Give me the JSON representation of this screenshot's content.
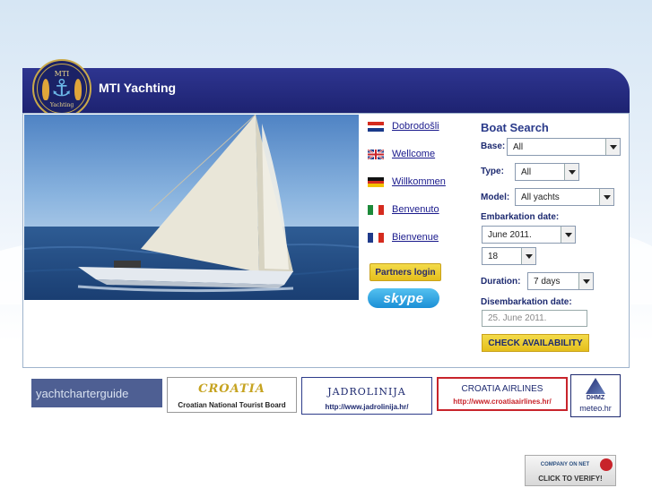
{
  "header": {
    "brand": "MTI Yachting",
    "logo_top": "MTI",
    "logo_bottom": "Yachting"
  },
  "languages": [
    {
      "label": "Dobrodošli",
      "flag": "hr"
    },
    {
      "label": "Wellcome",
      "flag": "uk"
    },
    {
      "label": "Willkommen",
      "flag": "de"
    },
    {
      "label": "Benvenuto",
      "flag": "it"
    },
    {
      "label": "Bienvenue",
      "flag": "fr"
    }
  ],
  "partners_login": "Partners login",
  "skype": "skype",
  "boat_search": {
    "title": "Boat Search",
    "base_label": "Base:",
    "base_value": "All",
    "type_label": "Type:",
    "type_value": "All",
    "model_label": "Model:",
    "model_value": "All yachts",
    "embarkation_label": "Embarkation date:",
    "embarkation_month": "June 2011.",
    "embarkation_day": "18",
    "duration_label": "Duration:",
    "duration_value": "7 days",
    "disembarkation_label": "Disembarkation date:",
    "disembarkation_value": "25. June 2011.",
    "check_button": "CHECK AVAILABILITY"
  },
  "banners": {
    "yachtcharterguide": "yachtcharterguide",
    "croatia_word": "CROATIA",
    "croatia_sub": "Croatian National Tourist Board",
    "jadrolinija_word": "JADROLINIJA",
    "jadrolinija_url": "http://www.jadrolinija.hr/",
    "croatia_airlines_word": "CROATIA AIRLINES",
    "croatia_airlines_url": "http://www.croatiaairlines.hr/",
    "dhmz_name": "DHMZ",
    "dhmz_site": "meteo.hr"
  },
  "verify": {
    "top": "COMPANY ON NET",
    "bottom": "CLICK TO VERIFY!"
  },
  "colors": {
    "header": "#1d2270",
    "button_yellow": "#e5bf1c",
    "link": "#1a1a8c"
  }
}
